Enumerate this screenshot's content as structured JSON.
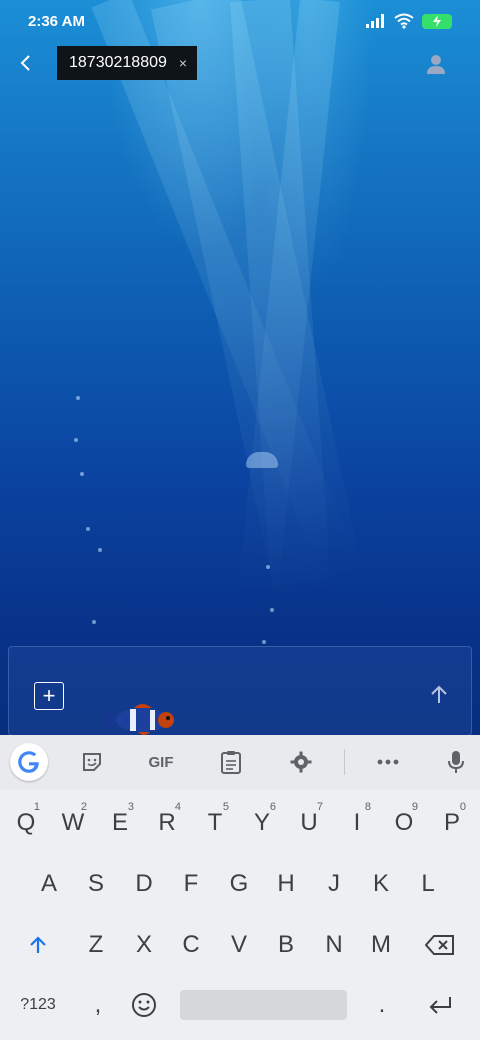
{
  "status_bar": {
    "time": "2:36 AM"
  },
  "header": {
    "recipient_chip": "18730218809",
    "chip_close": "×"
  },
  "composer": {
    "add_label": "+"
  },
  "keyboard": {
    "toolbar": {
      "gif_label": "GIF"
    },
    "row1": [
      {
        "key": "Q",
        "hint": "1"
      },
      {
        "key": "W",
        "hint": "2"
      },
      {
        "key": "E",
        "hint": "3"
      },
      {
        "key": "R",
        "hint": "4"
      },
      {
        "key": "T",
        "hint": "5"
      },
      {
        "key": "Y",
        "hint": "6"
      },
      {
        "key": "U",
        "hint": "7"
      },
      {
        "key": "I",
        "hint": "8"
      },
      {
        "key": "O",
        "hint": "9"
      },
      {
        "key": "P",
        "hint": "0"
      }
    ],
    "row2": [
      "A",
      "S",
      "D",
      "F",
      "G",
      "H",
      "J",
      "K",
      "L"
    ],
    "row3": [
      "Z",
      "X",
      "C",
      "V",
      "B",
      "N",
      "M"
    ],
    "symbols_label": "?123",
    "comma_label": ",",
    "period_label": "."
  }
}
